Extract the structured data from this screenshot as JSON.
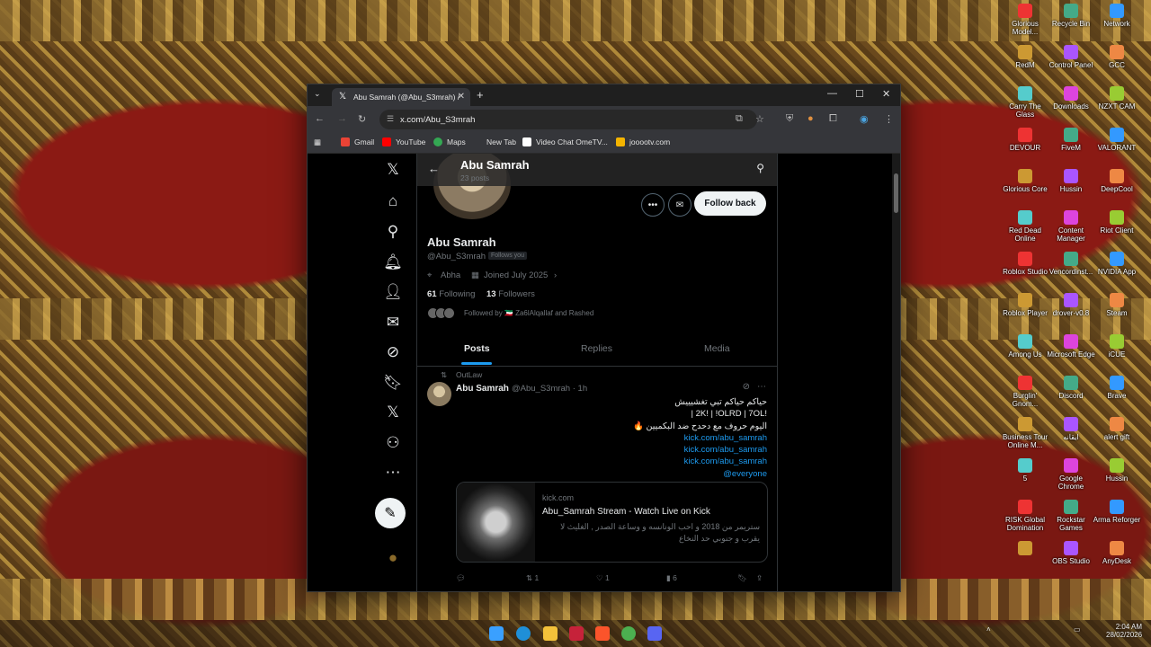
{
  "browser": {
    "tab_title": "Abu Samrah (@Abu_S3mrah) /",
    "url": "x.com/Abu_S3mrah",
    "bookmarks": [
      "Gmail",
      "YouTube",
      "Maps",
      "New Tab",
      "Video Chat OmeTV...",
      "jooootv.com"
    ]
  },
  "profile": {
    "header_name": "Abu Samrah",
    "header_posts": "23 posts",
    "name": "Abu Samrah",
    "handle": "@Abu_S3mrah",
    "follows_you": "Follows you",
    "location": "Abha",
    "joined": "Joined July 2025",
    "following_count": "61",
    "following_label": "Following",
    "followers_count": "13",
    "followers_label": "Followers",
    "followed_by": "Followed by 🇰🇼 Za6lAlqallaf and Rashed",
    "follow_back": "Follow back"
  },
  "tabs": [
    "Posts",
    "Replies",
    "Media"
  ],
  "post": {
    "reposted_by": "OutLaw",
    "author": "Abu Samrah",
    "handle_time": "@Abu_S3mrah · 1h",
    "lines": [
      "حياكم حياكم تبي تغشيييش",
      "| 2K! | !OLRD | 7OL!",
      "اليوم حروف مع دحدح ضد البكميين 🔥"
    ],
    "links": [
      "kick.com/abu_samrah",
      "kick.com/abu_samrah",
      "kick.com/abu_samrah",
      "@everyone"
    ],
    "card": {
      "domain": "kick.com",
      "title": "Abu_Samrah Stream - Watch Live on Kick",
      "description": "ستريمر من 2018 و احب الونانسه و وساعة الصدر , الغليث لا يقرب و جنوبي حد النخاع"
    },
    "reply_count": "",
    "repost_count": "1",
    "like_count": "1",
    "views_count": "6"
  },
  "desktop_icons": [
    "Glorious Model...",
    "Recycle Bin",
    "Network",
    "RedM",
    "Control Panel",
    "GCC",
    "Carry The Glass",
    "Downloads",
    "NZXT CAM",
    "DEVOUR",
    "FiveM",
    "VALORANT",
    "Glorious Core",
    "Hussin",
    "DeepCool",
    "Red Dead Online",
    "Content Manager",
    "Riot Client",
    "Roblox Studio",
    "Vencordinst...",
    "NVIDIA App",
    "Roblox Player",
    "drover-v0.8",
    "Steam",
    "Among Us",
    "Microsoft Edge",
    "iCUE",
    "Burglin' Gnom...",
    "Discord",
    "Brave",
    "Business Tour Online M...",
    "ايقانه",
    "alert gift",
    "5",
    "Google Chrome",
    "Hussin",
    "RISK Global Domination",
    "Rockstar Games",
    "Arma Reforger",
    "",
    "OBS Studio",
    "AnyDesk"
  ],
  "system": {
    "time": "2:04 AM",
    "date": "28/02/2026"
  },
  "colors": {
    "accent": "#1d9bf0",
    "bg": "#000000",
    "text": "#e7e9ea",
    "muted": "#71767b"
  }
}
